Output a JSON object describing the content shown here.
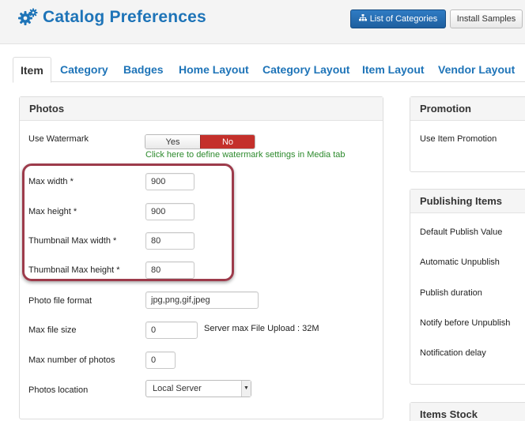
{
  "header": {
    "title": "Catalog Preferences",
    "title_icon": "gears-icon",
    "buttons": {
      "list_categories": "List of Categories",
      "install_samples": "Install Samples"
    }
  },
  "tabs": [
    {
      "label": "Item",
      "active": true
    },
    {
      "label": "Category"
    },
    {
      "label": "Badges"
    },
    {
      "label": "Home Layout"
    },
    {
      "label": "Category Layout"
    },
    {
      "label": "Item Layout"
    },
    {
      "label": "Vendor Layout"
    }
  ],
  "photos": {
    "title": "Photos",
    "use_watermark": {
      "label": "Use Watermark",
      "yes": "Yes",
      "no": "No",
      "selected": "No",
      "hint": "Click here to define watermark settings in Media tab"
    },
    "max_width": {
      "label": "Max width *",
      "value": "900"
    },
    "max_height": {
      "label": "Max height *",
      "value": "900"
    },
    "thumb_width": {
      "label": "Thumbnail Max width *",
      "value": "80"
    },
    "thumb_height": {
      "label": "Thumbnail Max height *",
      "value": "80"
    },
    "file_format": {
      "label": "Photo file format",
      "value": "jpg,png,gif,jpeg"
    },
    "max_file_size": {
      "label": "Max file size",
      "value": "0",
      "note": "Server max File Upload : 32M"
    },
    "max_photos": {
      "label": "Max number of photos",
      "value": "0"
    },
    "location": {
      "label": "Photos location",
      "value": "Local Server"
    }
  },
  "promotion": {
    "title": "Promotion",
    "use_item_promotion": "Use Item Promotion"
  },
  "publishing": {
    "title": "Publishing Items",
    "labels": [
      "Default Publish Value",
      "Automatic Unpublish",
      "Publish duration",
      "Notify before Unpublish",
      "Notification delay"
    ]
  },
  "stock": {
    "title": "Items Stock"
  },
  "colors": {
    "accent": "#1e74b8",
    "toggle_no": "#c4302b",
    "hint": "#2d8a2d",
    "highlight": "#9d3b4b"
  }
}
